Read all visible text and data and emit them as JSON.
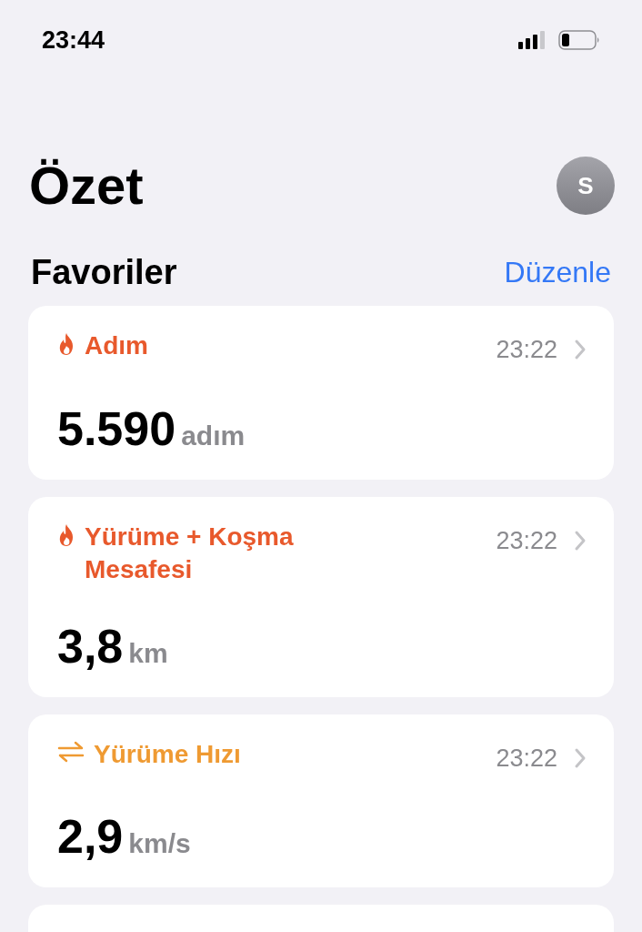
{
  "status_bar": {
    "time": "23:44"
  },
  "header": {
    "title": "Özet",
    "avatar": "S"
  },
  "favorites": {
    "title": "Favoriler",
    "edit": "Düzenle"
  },
  "cards": [
    {
      "kind": "flame",
      "color": "#e8592c",
      "title": "Adım",
      "time": "23:22",
      "value": "5.590",
      "unit": "adım"
    },
    {
      "kind": "flame",
      "color": "#e8592c",
      "title": "Yürüme + Koşma Mesafesi",
      "time": "23:22",
      "value": "3,8",
      "unit": "km"
    },
    {
      "kind": "arrows",
      "color": "#ef9a32",
      "title": "Yürüme Hızı",
      "time": "23:22",
      "value": "2,9",
      "unit": "km/s"
    }
  ]
}
